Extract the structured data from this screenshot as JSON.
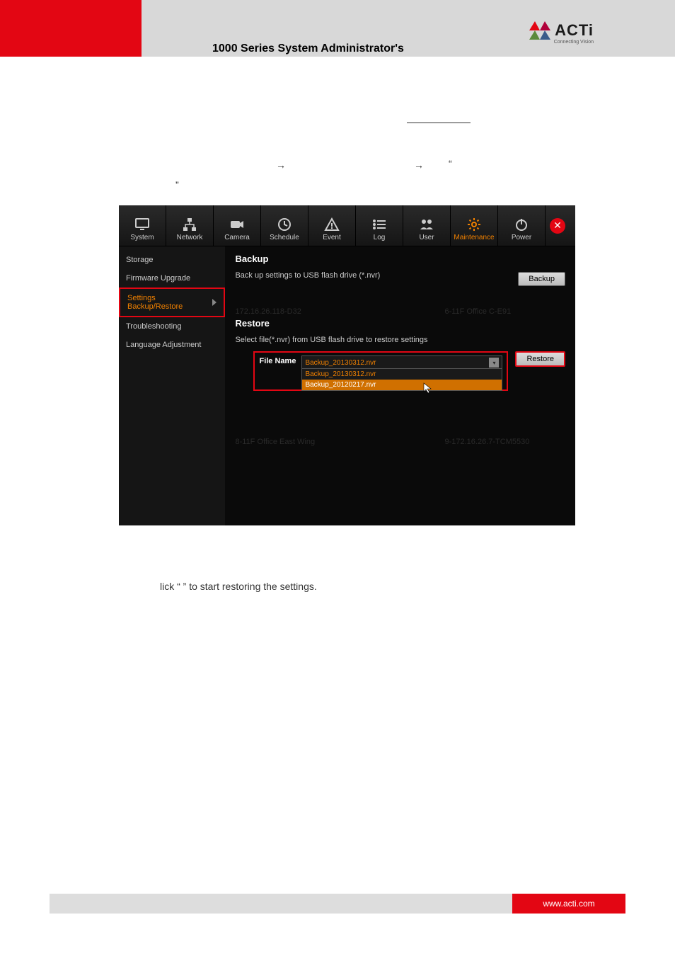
{
  "doc": {
    "title": "1000 Series System Administrator's",
    "logo_text": "ACTi",
    "logo_tagline": "Connecting Vision",
    "footer_url": "www.acti.com",
    "arrow": "→",
    "quote_open": "“",
    "quote_close": "”",
    "instruction": "lick “            ” to start restoring the settings."
  },
  "nav": [
    {
      "label": "System"
    },
    {
      "label": "Network"
    },
    {
      "label": "Camera"
    },
    {
      "label": "Schedule"
    },
    {
      "label": "Event"
    },
    {
      "label": "Log"
    },
    {
      "label": "User"
    },
    {
      "label": "Maintenance",
      "active": true
    },
    {
      "label": "Power"
    }
  ],
  "sidebar": {
    "items": [
      {
        "label": "Storage"
      },
      {
        "label": "Firmware Upgrade"
      },
      {
        "label": "Settings Backup/Restore",
        "active": true
      },
      {
        "label": "Troubleshooting"
      },
      {
        "label": "Language Adjustment"
      }
    ]
  },
  "panel": {
    "backup_title": "Backup",
    "backup_desc": "Back up settings to USB flash drive (*.nvr)",
    "backup_btn": "Backup",
    "restore_title": "Restore",
    "restore_desc": "Select file(*.nvr) from USB flash drive to restore settings",
    "file_label": "File Name",
    "restore_btn": "Restore",
    "dropdown": {
      "selected": "Backup_20130312.nvr",
      "options": [
        "Backup_20130312.nvr",
        "Backup_20120217.nvr"
      ]
    }
  },
  "ghost": {
    "g1": "172.16.26.118-D32",
    "g2": "6-11F Office C-E91",
    "g3": "8-11F Office East Wing",
    "g4": "9-172.16.26.7-TCM5530"
  }
}
